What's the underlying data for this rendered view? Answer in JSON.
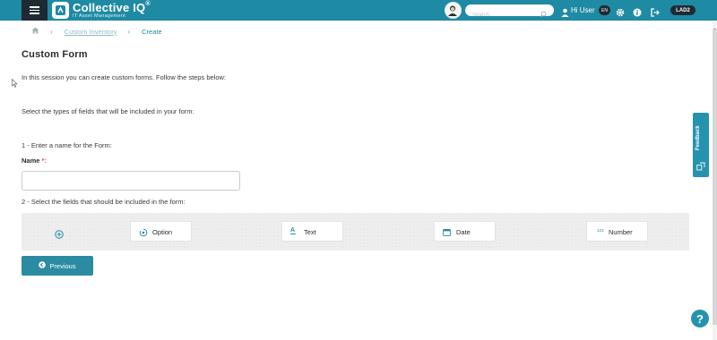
{
  "header": {
    "brand_name": "Collective IQ",
    "brand_mark": "®",
    "brand_tagline": "IT Asset Management",
    "search_placeholder": "Search",
    "greeting": "Hi User",
    "language": "EN",
    "environment": "LAD2",
    "accent_color": "#1f8aa3",
    "icons": [
      "menu-icon",
      "logo-icon",
      "avatar",
      "search-icon",
      "user-icon",
      "gear-icon",
      "info-icon",
      "logout-icon"
    ]
  },
  "breadcrumb": {
    "items": [
      {
        "label": "Custom Inventory"
      },
      {
        "label": "Create"
      }
    ]
  },
  "page": {
    "title": "Custom Form",
    "intro": "In this session you can create custom forms. Follow the steps below:",
    "select_types": "Select the types of fields that will be included in your form:",
    "step1": "1 - Enter a name for the Form:",
    "name_label": "Name",
    "required_mark": "*:",
    "name_value": "",
    "step2": "2 - Select the fields that should be included in the form:"
  },
  "fields": [
    {
      "label": "Option",
      "icon": "option-icon"
    },
    {
      "label": "Text",
      "icon": "text-icon"
    },
    {
      "label": "Date",
      "icon": "calendar-icon"
    },
    {
      "label": "Number",
      "icon": "number-icon"
    }
  ],
  "number_glyph": "123",
  "text_glyph": "A",
  "buttons": {
    "previous": "Previous"
  },
  "feedback": {
    "label": "Feedback"
  },
  "help": {
    "label": "?"
  }
}
